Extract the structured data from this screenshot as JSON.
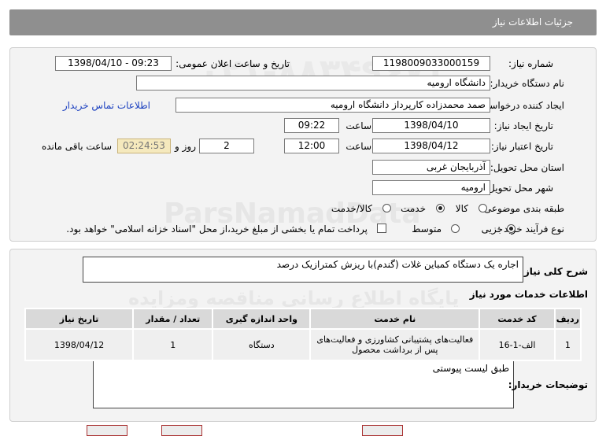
{
  "header": {
    "title": "جزئیات اطلاعات نیاز"
  },
  "form": {
    "need_number_label": "شماره نیاز:",
    "need_number": "1198009033000159",
    "announce_label": "تاریخ و ساعت اعلان عمومی:",
    "announce_value": "1398/04/10 - 09:23",
    "buyer_org_label": "نام دستگاه خریدار:",
    "buyer_org": "دانشگاه ارومیه",
    "creator_label": "ایجاد کننده درخواست:",
    "creator": "صمد محمدزاده کارپرداز دانشگاه ارومیه",
    "contact_link": "اطلاعات تماس خریدار",
    "created_date_label": "تاریخ ایجاد نیاز:",
    "created_date": "1398/04/10",
    "time_label": "ساعت",
    "created_time": "09:22",
    "validity_label": "تاریخ اعتبار نیاز:",
    "validity_date": "1398/04/12",
    "validity_time": "12:00",
    "days_label": "روز و",
    "days": "2",
    "remaining": "02:24:53",
    "remaining_label": "ساعت باقی مانده",
    "province_label": "استان محل تحویل:",
    "province": "آذربایجان غربی",
    "city_label": "شهر محل تحویل:",
    "city": "ارومیه",
    "category_label": "طبقه بندی موضوعی:",
    "category_options": [
      "کالا",
      "خدمت",
      "کالا/خدمت"
    ],
    "category_selected": "خدمت",
    "process_label": "نوع فرآیند خرید :",
    "process_options": [
      "جزیی",
      "متوسط"
    ],
    "process_selected": "جزیی",
    "payment_note": "پرداخت تمام یا بخشی از مبلغ خرید،از محل \"اسناد خزانه اسلامی\" خواهد بود."
  },
  "summary": {
    "label": "شرح کلی نیاز:",
    "value": "اجاره یک دستگاه کمباین غلات (گندم)با ریزش کمترازیک درصد"
  },
  "services": {
    "title": "اطلاعات خدمات مورد نیاز",
    "columns": [
      "ردیف",
      "کد خدمت",
      "نام خدمت",
      "واحد اندازه گیری",
      "تعداد / مقدار",
      "تاریخ نیاز"
    ],
    "rows": [
      {
        "index": "1",
        "code": "الف-1-16",
        "name": "فعالیت‌های پشتیبانی کشاورزی و فعالیت‌های پس از برداشت محصول",
        "unit": "دستگاه",
        "quantity": "1",
        "date": "1398/04/12"
      }
    ]
  },
  "buyer_notes": {
    "label": "توضیحات خریدار:",
    "value": "طبق لیست پیوستی"
  },
  "watermark": {
    "line1": "ParsNamadData",
    "line2": "پایگاه اطلاع رسانی مناقصه ومزایده",
    "phone": "۰۲۱-۸۸۳۴۹۶۷۰"
  },
  "colors": {
    "header_bg": "#8f8f8f",
    "panel_bg": "#f3f3f3",
    "remaining_bg": "#f5e9bd",
    "link": "#1a3fbf"
  }
}
